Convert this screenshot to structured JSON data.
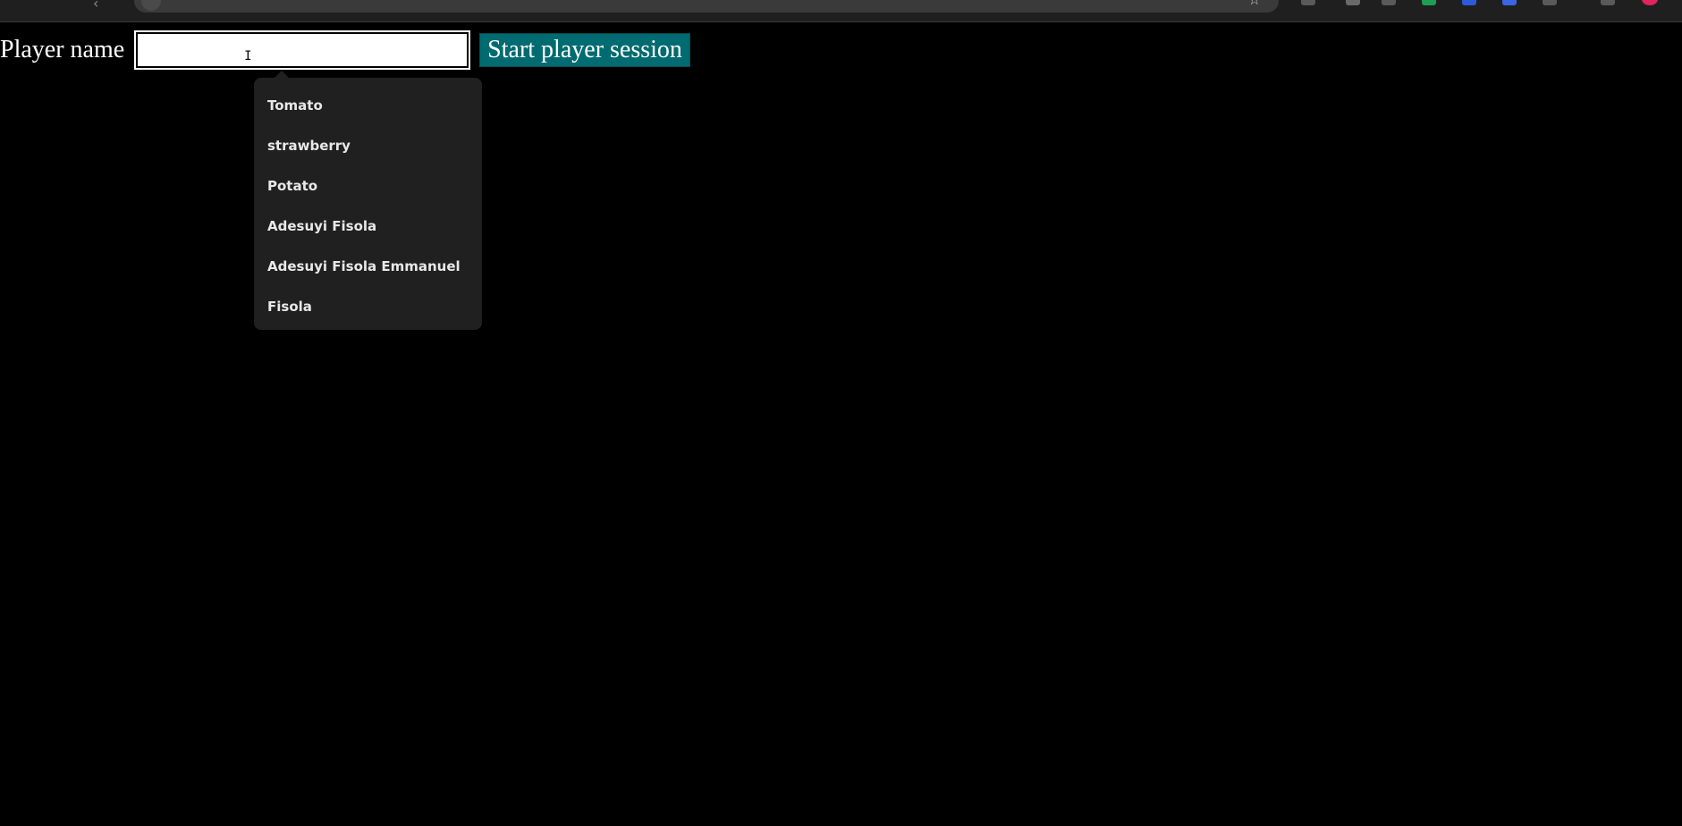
{
  "browser": {
    "back_glyph": "‹",
    "star_glyph": "☆"
  },
  "form": {
    "label": "Player name",
    "input_value": "",
    "input_placeholder": "",
    "cursor_glyph": "I",
    "submit_label": "Start player session"
  },
  "datalist": {
    "options": [
      "Tomato",
      "strawberry",
      "Potato",
      "Adesuyi Fisola",
      "Adesuyi Fisola Emmanuel",
      "Fisola"
    ]
  },
  "colors": {
    "page_background": "#000000",
    "button_background": "#006b70",
    "dropdown_background": "#202020"
  }
}
